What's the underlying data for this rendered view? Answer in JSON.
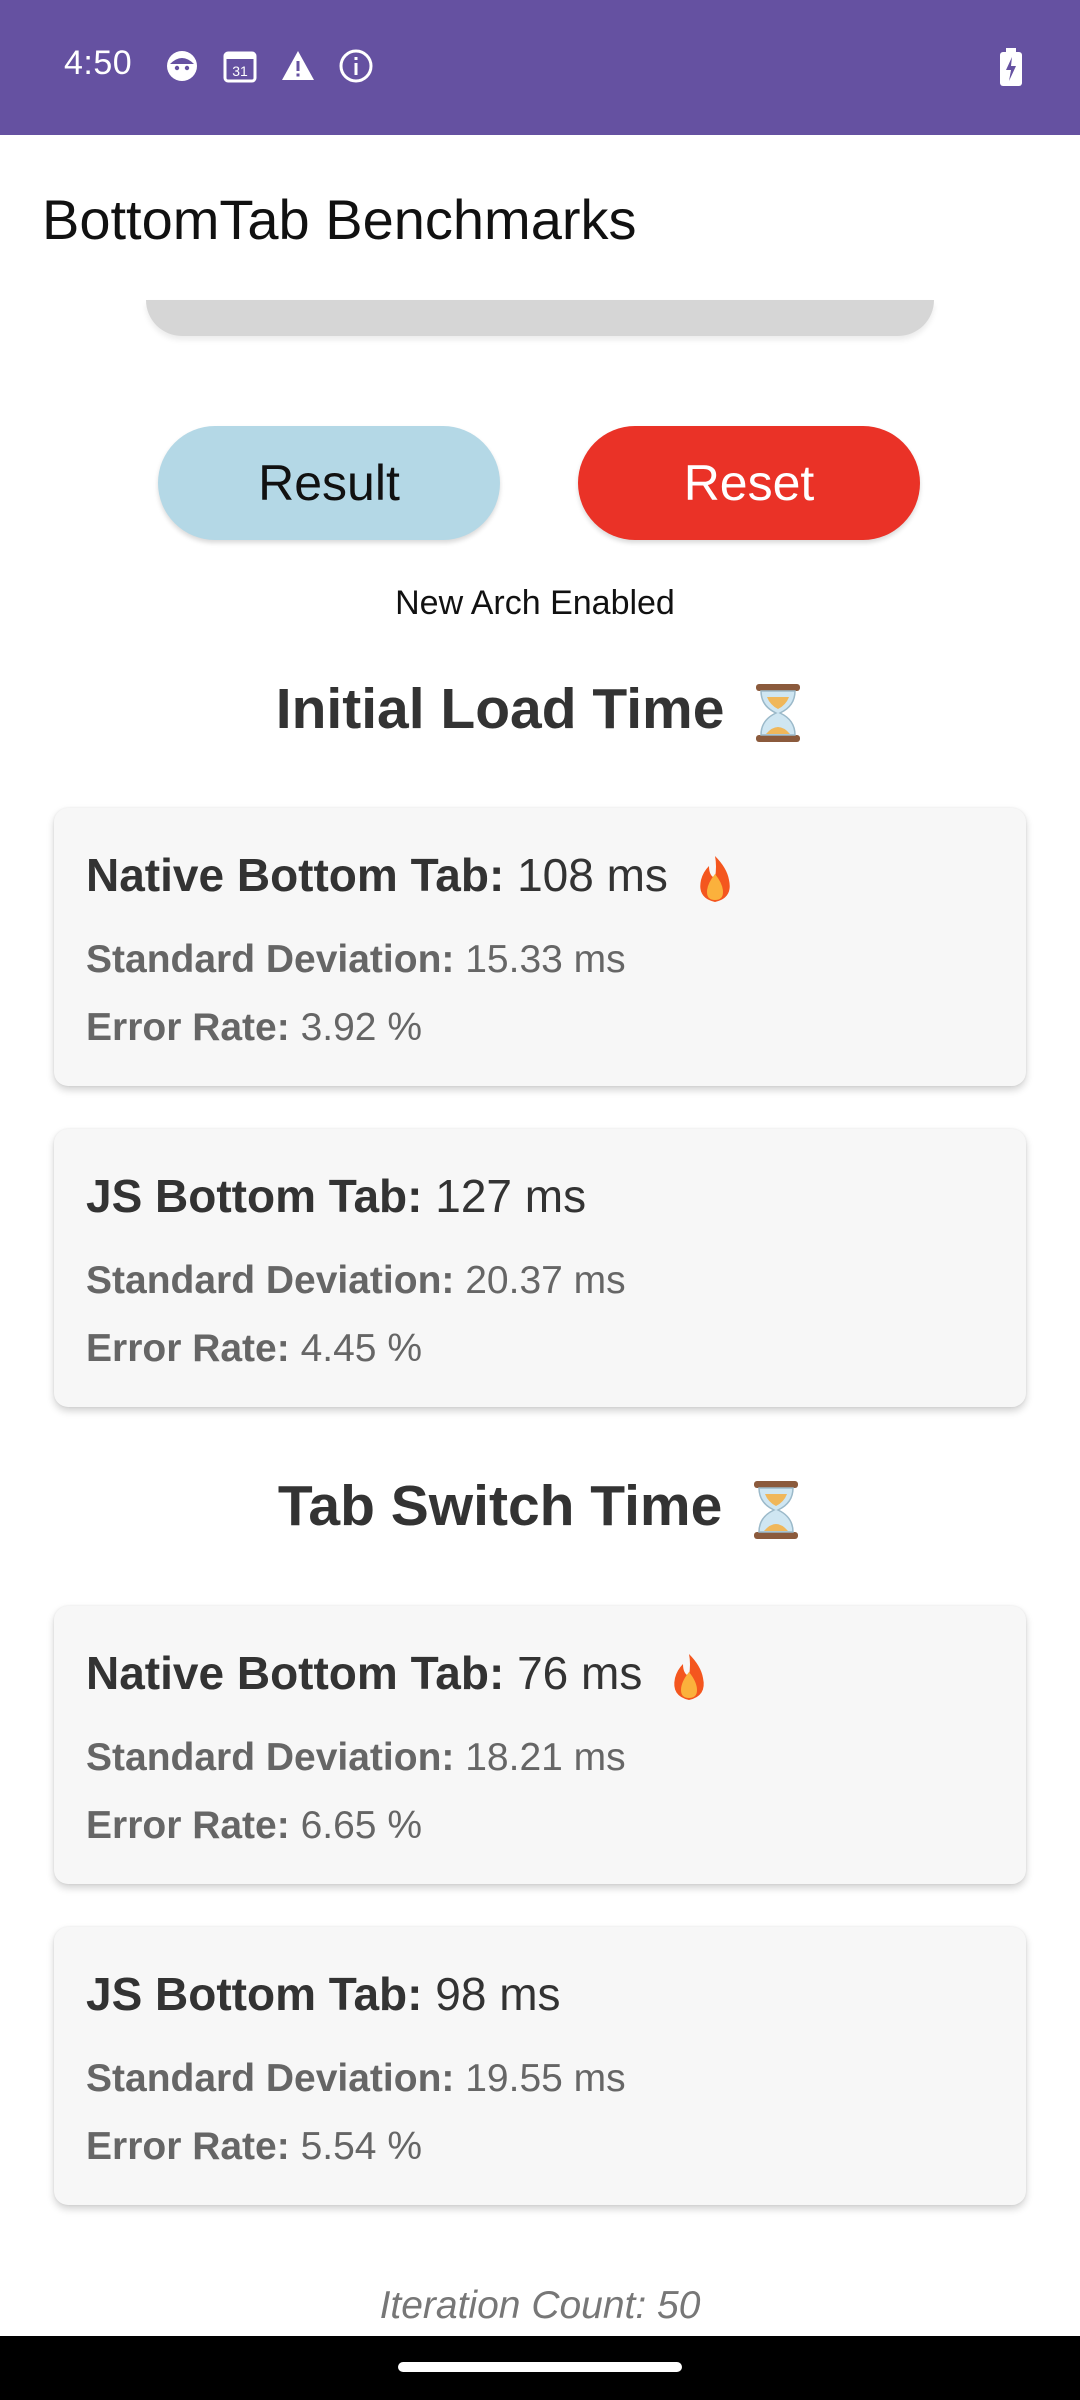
{
  "status_bar": {
    "time": "4:50",
    "icons": [
      "face-icon",
      "calendar-icon",
      "warning-icon",
      "info-icon"
    ],
    "calendar_day": "31",
    "battery_icon": "battery-charging-icon",
    "color": "#6551a1"
  },
  "header": {
    "title": "BottomTab Benchmarks"
  },
  "buttons": {
    "result_label": "Result",
    "reset_label": "Reset",
    "result_color": "#b4d8e6",
    "reset_color": "#ea3227"
  },
  "arch_label": "New Arch Enabled",
  "sections": [
    {
      "title": "Initial Load Time",
      "icon": "hourglass-icon",
      "cards": [
        {
          "name_label": "Native Bottom Tab:",
          "value": "108 ms",
          "highlight_icon": "fire-icon",
          "std_label": "Standard Deviation:",
          "std_value": "15.33 ms",
          "err_label": "Error Rate:",
          "err_value": "3.92 %"
        },
        {
          "name_label": "JS Bottom Tab:",
          "value": "127 ms",
          "std_label": "Standard Deviation:",
          "std_value": "20.37 ms",
          "err_label": "Error Rate:",
          "err_value": "4.45 %"
        }
      ]
    },
    {
      "title": "Tab Switch Time",
      "icon": "hourglass-icon",
      "cards": [
        {
          "name_label": "Native Bottom Tab:",
          "value": "76 ms",
          "highlight_icon": "fire-icon",
          "std_label": "Standard Deviation:",
          "std_value": "18.21 ms",
          "err_label": "Error Rate:",
          "err_value": "6.65 %"
        },
        {
          "name_label": "JS Bottom Tab:",
          "value": "98 ms",
          "std_label": "Standard Deviation:",
          "std_value": "19.55 ms",
          "err_label": "Error Rate:",
          "err_value": "5.54 %"
        }
      ]
    }
  ],
  "iteration_label": "Iteration Count: 50"
}
